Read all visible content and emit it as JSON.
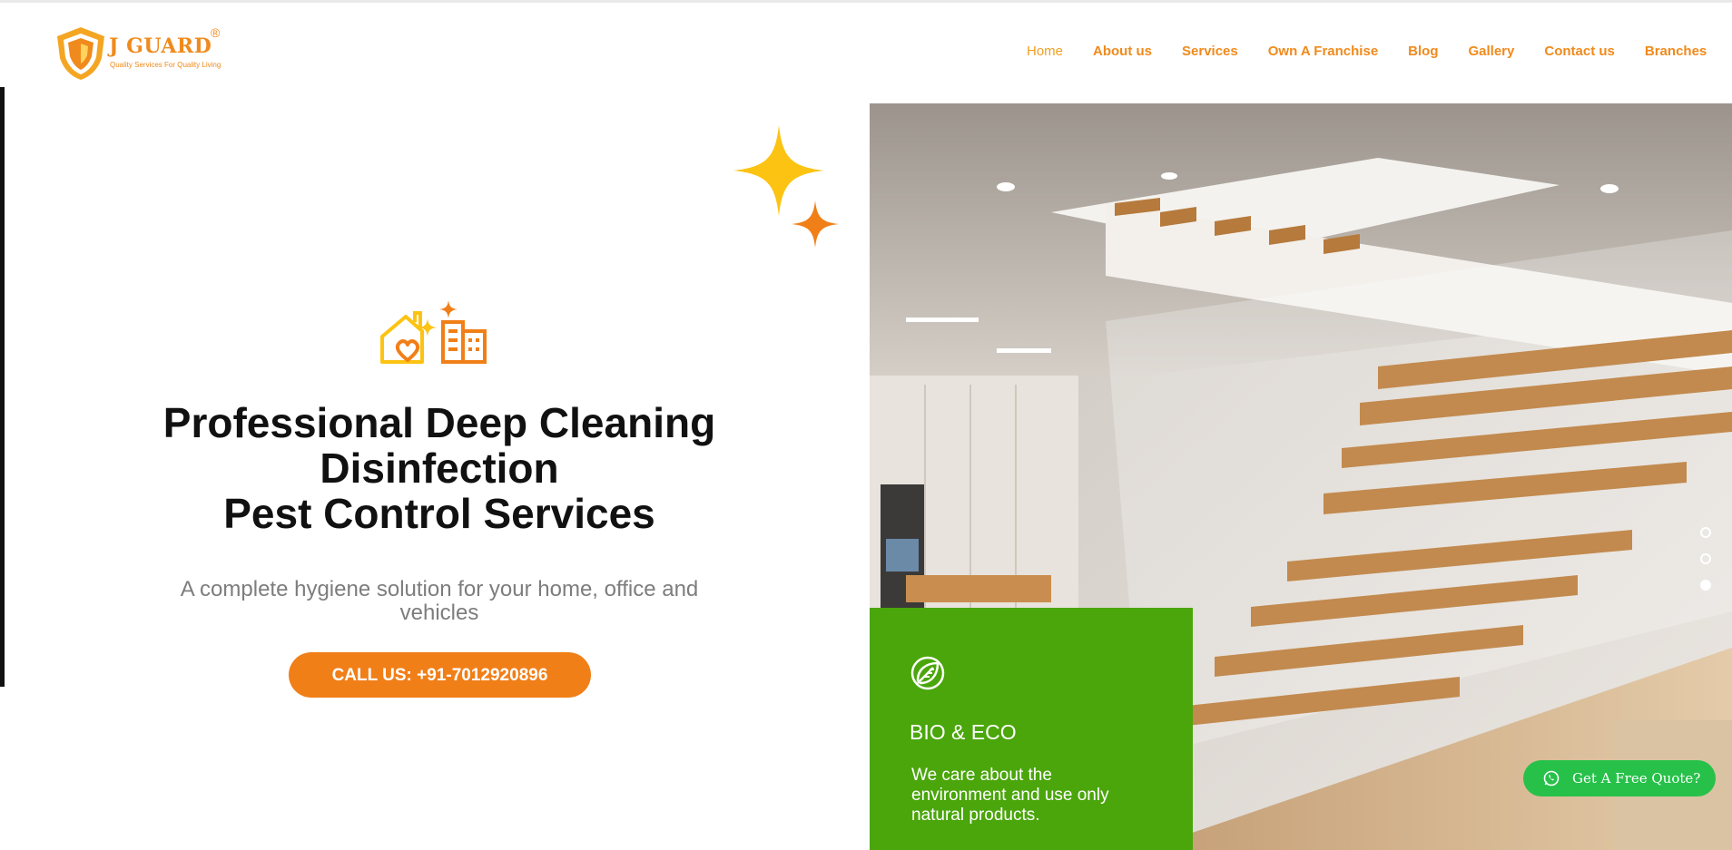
{
  "brand": {
    "name": "J GUARD",
    "registered": "®",
    "tagline": "Quality Services For Quality Living"
  },
  "nav": {
    "items": [
      {
        "label": "Home",
        "active": true
      },
      {
        "label": "About us"
      },
      {
        "label": "Services"
      },
      {
        "label": "Own A Franchise"
      },
      {
        "label": "Blog"
      },
      {
        "label": "Gallery"
      },
      {
        "label": "Contact us"
      },
      {
        "label": "Branches"
      }
    ]
  },
  "hero": {
    "title_lines": [
      "Professional Deep Cleaning",
      "Disinfection",
      "Pest Control Services"
    ],
    "subtitle": "A complete hygiene solution for your home, office and vehicles",
    "cta_label": "CALL US: +91-7012920896",
    "icon": "home-building-sparkle-icon"
  },
  "slider": {
    "slide_count": 3,
    "active_index": 2
  },
  "eco_card": {
    "icon": "leaf-icon",
    "title": "BIO & ECO",
    "text": "We care about the environment and use only natural products."
  },
  "quote_button": {
    "label": "Get A Free Quote?",
    "icon": "whatsapp-icon"
  },
  "colors": {
    "brand_orange": "#f08a1c",
    "button_orange": "#f17f18",
    "sparkle_yellow": "#fcc312",
    "eco_green": "#4aa60b",
    "quote_green": "#27c14a",
    "title_text": "#111111",
    "subtitle_text": "#7d7d7d"
  }
}
